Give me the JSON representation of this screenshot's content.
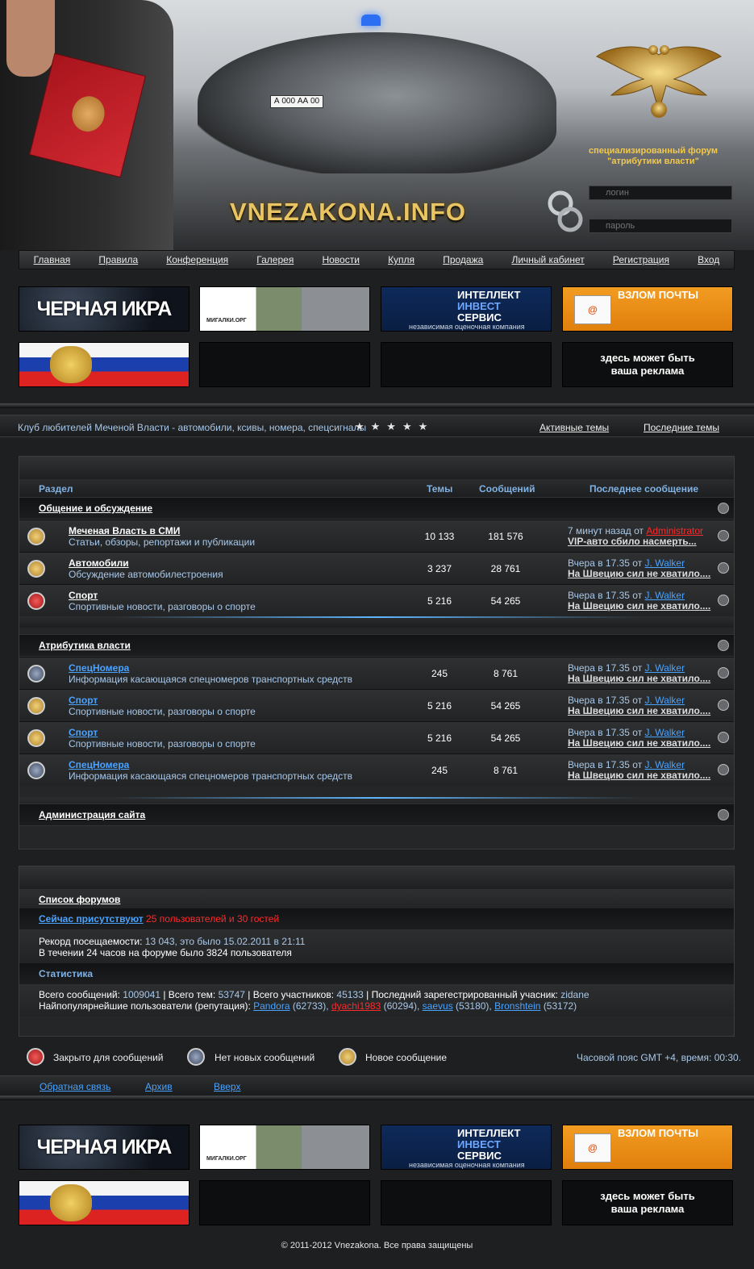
{
  "header": {
    "logo_text": "VNEZAKONA.INFO",
    "car_plate": "А 000 АА 00",
    "caption_line1": "специализированный форум",
    "caption_line2": "\"атрибутики власти\"",
    "login_placeholder": "логин",
    "password_placeholder": "пароль"
  },
  "nav": [
    "Главная",
    "Правила",
    "Конференция",
    "Галерея",
    "Новости",
    "Купля",
    "Продажа",
    "Личный кабинет",
    "Регистрация",
    "Вход"
  ],
  "banners": {
    "ikra": "ЧЕРНАЯ ИКРА",
    "migalki": "МИГАЛКИ.ОРГ",
    "invest_1": "ИНТЕЛЛЕКТ",
    "invest_2": "ИНВЕСТ",
    "invest_3": "СЕРВИС",
    "invest_sub": "независимая оценочная компания",
    "mail": "ВЗЛОМ ПОЧТЫ",
    "mail_icon": "@",
    "ad_line1": "здесь может быть",
    "ad_line2": "ваша реклама"
  },
  "club": {
    "text": "Клуб любителей Меченой Власти - автомобили, ксивы, номера, спецсигналы",
    "stars": "★★★★★",
    "active_topics": "Активные темы",
    "last_topics": "Последние темы"
  },
  "columns": {
    "section": "Раздел",
    "topics": "Темы",
    "posts": "Сообщений",
    "last": "Последнее сообщение"
  },
  "categories": [
    {
      "title": "Общение и обсуждение",
      "forums": [
        {
          "icon": "new",
          "title": "Меченая Власть в СМИ",
          "desc": "Статьи, обзоры, репортажи и публикации",
          "topics": "10 133",
          "posts": "181 576",
          "when": "7 минут назад от",
          "author": "Administrator",
          "author_color": "#ff2a2a",
          "post": "VIP-авто сбило насмерть..."
        },
        {
          "icon": "new",
          "title": "Автомобили",
          "desc": "Обсуждение автомобилестроения",
          "topics": "3 237",
          "posts": "28 761",
          "when": "Вчера в 17.35 от",
          "author": "J. Walker",
          "author_color": "#4aa3ff",
          "post": "На Швецию сил не хватило...."
        },
        {
          "icon": "closed",
          "title": "Спорт",
          "desc": "Спортивные новости, разговоры о спорте",
          "topics": "5 216",
          "posts": "54 265",
          "when": "Вчера в 17.35 от",
          "author": "J. Walker",
          "author_color": "#4aa3ff",
          "post": "На Швецию сил не хватило...."
        }
      ]
    },
    {
      "title": "Атрибутика власти",
      "forums": [
        {
          "icon": "none",
          "title": "СпецНомера",
          "desc": "Информация касающаяся спецномеров транспортных средств",
          "topics": "245",
          "posts": "8 761",
          "when": "Вчера в 17.35 от",
          "author": "J. Walker",
          "author_color": "#4aa3ff",
          "post": "На Швецию сил не хватило...."
        },
        {
          "icon": "new",
          "title": "Спорт",
          "desc": "Спортивные новости, разговоры о спорте",
          "topics": "5 216",
          "posts": "54 265",
          "when": "Вчера в 17.35 от",
          "author": "J. Walker",
          "author_color": "#4aa3ff",
          "post": "На Швецию сил не хватило...."
        },
        {
          "icon": "new",
          "title": "Спорт",
          "desc": "Спортивные новости, разговоры о спорте",
          "topics": "5 216",
          "posts": "54 265",
          "when": "Вчера в 17.35 от",
          "author": "J. Walker",
          "author_color": "#4aa3ff",
          "post": "На Швецию сил не хватило...."
        },
        {
          "icon": "none",
          "title": "СпецНомера",
          "desc": "Информация касающаяся спецномеров транспортных средств",
          "topics": "245",
          "posts": "8 761",
          "when": "Вчера в 17.35 от",
          "author": "J. Walker",
          "author_color": "#4aa3ff",
          "post": "На Швецию сил не хватило...."
        }
      ]
    },
    {
      "title": "Администрация сайта",
      "forums": []
    }
  ],
  "stats": {
    "forum_list": "Список форумов",
    "online_label": "Сейчас присутствуют",
    "online_value": "25 пользователей и 30 гостей",
    "record_label": "Рекорд посещаемости:",
    "record_value": "13 043, это было 15.02.2011 в 21:11",
    "day_line": "В течении 24 часов на форуме было 3824 пользователя",
    "stat_title": "Статистика",
    "total_posts_label": "Всего сообщений:",
    "total_posts": "1009041",
    "total_topics_label": "| Всего тем:",
    "total_topics": "53747",
    "total_members_label": "| Всего участников:",
    "total_members": "45133",
    "last_reg_label": "| Последний зарегестрированный учасник:",
    "last_reg": "zidane",
    "popular_label": "Найпопулярнейшие пользователи (репутация):",
    "popular": [
      {
        "name": "Pandora",
        "rep": "(62733),",
        "color": "#4aa3ff"
      },
      {
        "name": "dyachi1983",
        "rep": "(60294),",
        "color": "#ff2a2a"
      },
      {
        "name": "saevus",
        "rep": "(53180),",
        "color": "#4aa3ff"
      },
      {
        "name": "Bronshtein",
        "rep": "(53172)",
        "color": "#4aa3ff"
      }
    ]
  },
  "legend": {
    "closed": "Закрыто для сообщений",
    "none": "Нет новых сообщений",
    "new": "Новое сообщение",
    "timezone": "Часовой пояс GMT +4, время: 00:30."
  },
  "footer": {
    "feedback": "Обратная связь",
    "archive": "Архив",
    "up": "Вверх",
    "copyright": "© 2011-2012 Vnezakona. Все права защищены"
  }
}
